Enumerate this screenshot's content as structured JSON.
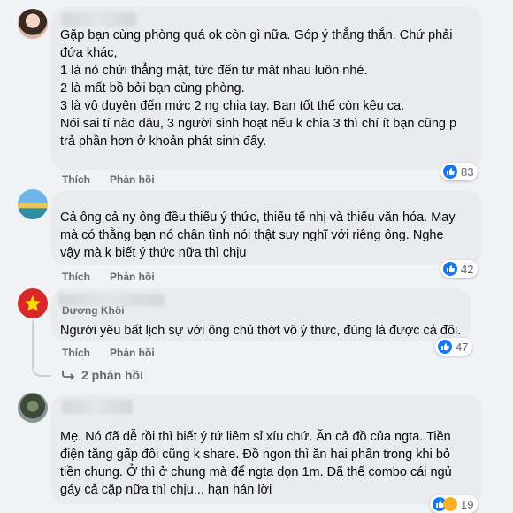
{
  "actions": {
    "like": "Thích",
    "reply": "Phản hồi"
  },
  "comments": [
    {
      "name": "",
      "lines": [
        "Gặp bạn cùng phòng quá ok còn gì nữa. Góp ý thẳng thắn. Chứ phải",
        "đứa khác,",
        "1 là nó chửi thẳng mặt, tức đến từ mặt nhau luôn nhé.",
        "2 là mất bồ bởi bạn cùng phòng.",
        "3 là vô duyên đến mức 2 ng chia tay. Bạn tốt thế còn kêu ca.",
        "Nói sai tí nào đâu, 3 người sinh hoạt nếu k chia 3 thì chí ít bạn cũng p",
        "trả phần hơn ở khoản phát sinh đấy."
      ],
      "reactions": "83"
    },
    {
      "name": "",
      "lines": [
        "Cả ông cả ny ông đều thiếu ý thức, thiếu tế nhị và thiếu văn hóa. May",
        "mà có thằng bạn nó chân tình nói thật suy nghĩ với riêng ông. Nghe",
        "vậy mà k biết ý thức nữa thì chịu"
      ],
      "reactions": "42"
    },
    {
      "name": "Dương Khôi",
      "lines": [
        "Người yêu bất lịch sự với ông chủ thớt vô ý thức, đúng là được cả đôi."
      ],
      "reactions": "47",
      "replies_label": "2 phản hồi"
    },
    {
      "name": "",
      "lines": [
        "Mẹ. Nó đã dễ rồi thì biết ý tứ liêm sỉ xíu chứ. Ăn cả đồ của ngta. Tiền",
        "điện tăng gấp đôi cũng k share. Đồ ngon thì ăn hai phần trong khi bỏ",
        "tiền chung. Ở thì ở chung mà để ngta dọn 1m. Đã thế combo cái ngủ",
        "gáy cả cặp nữa thì chịu... hạn hán lời"
      ],
      "reactions": "19"
    }
  ]
}
